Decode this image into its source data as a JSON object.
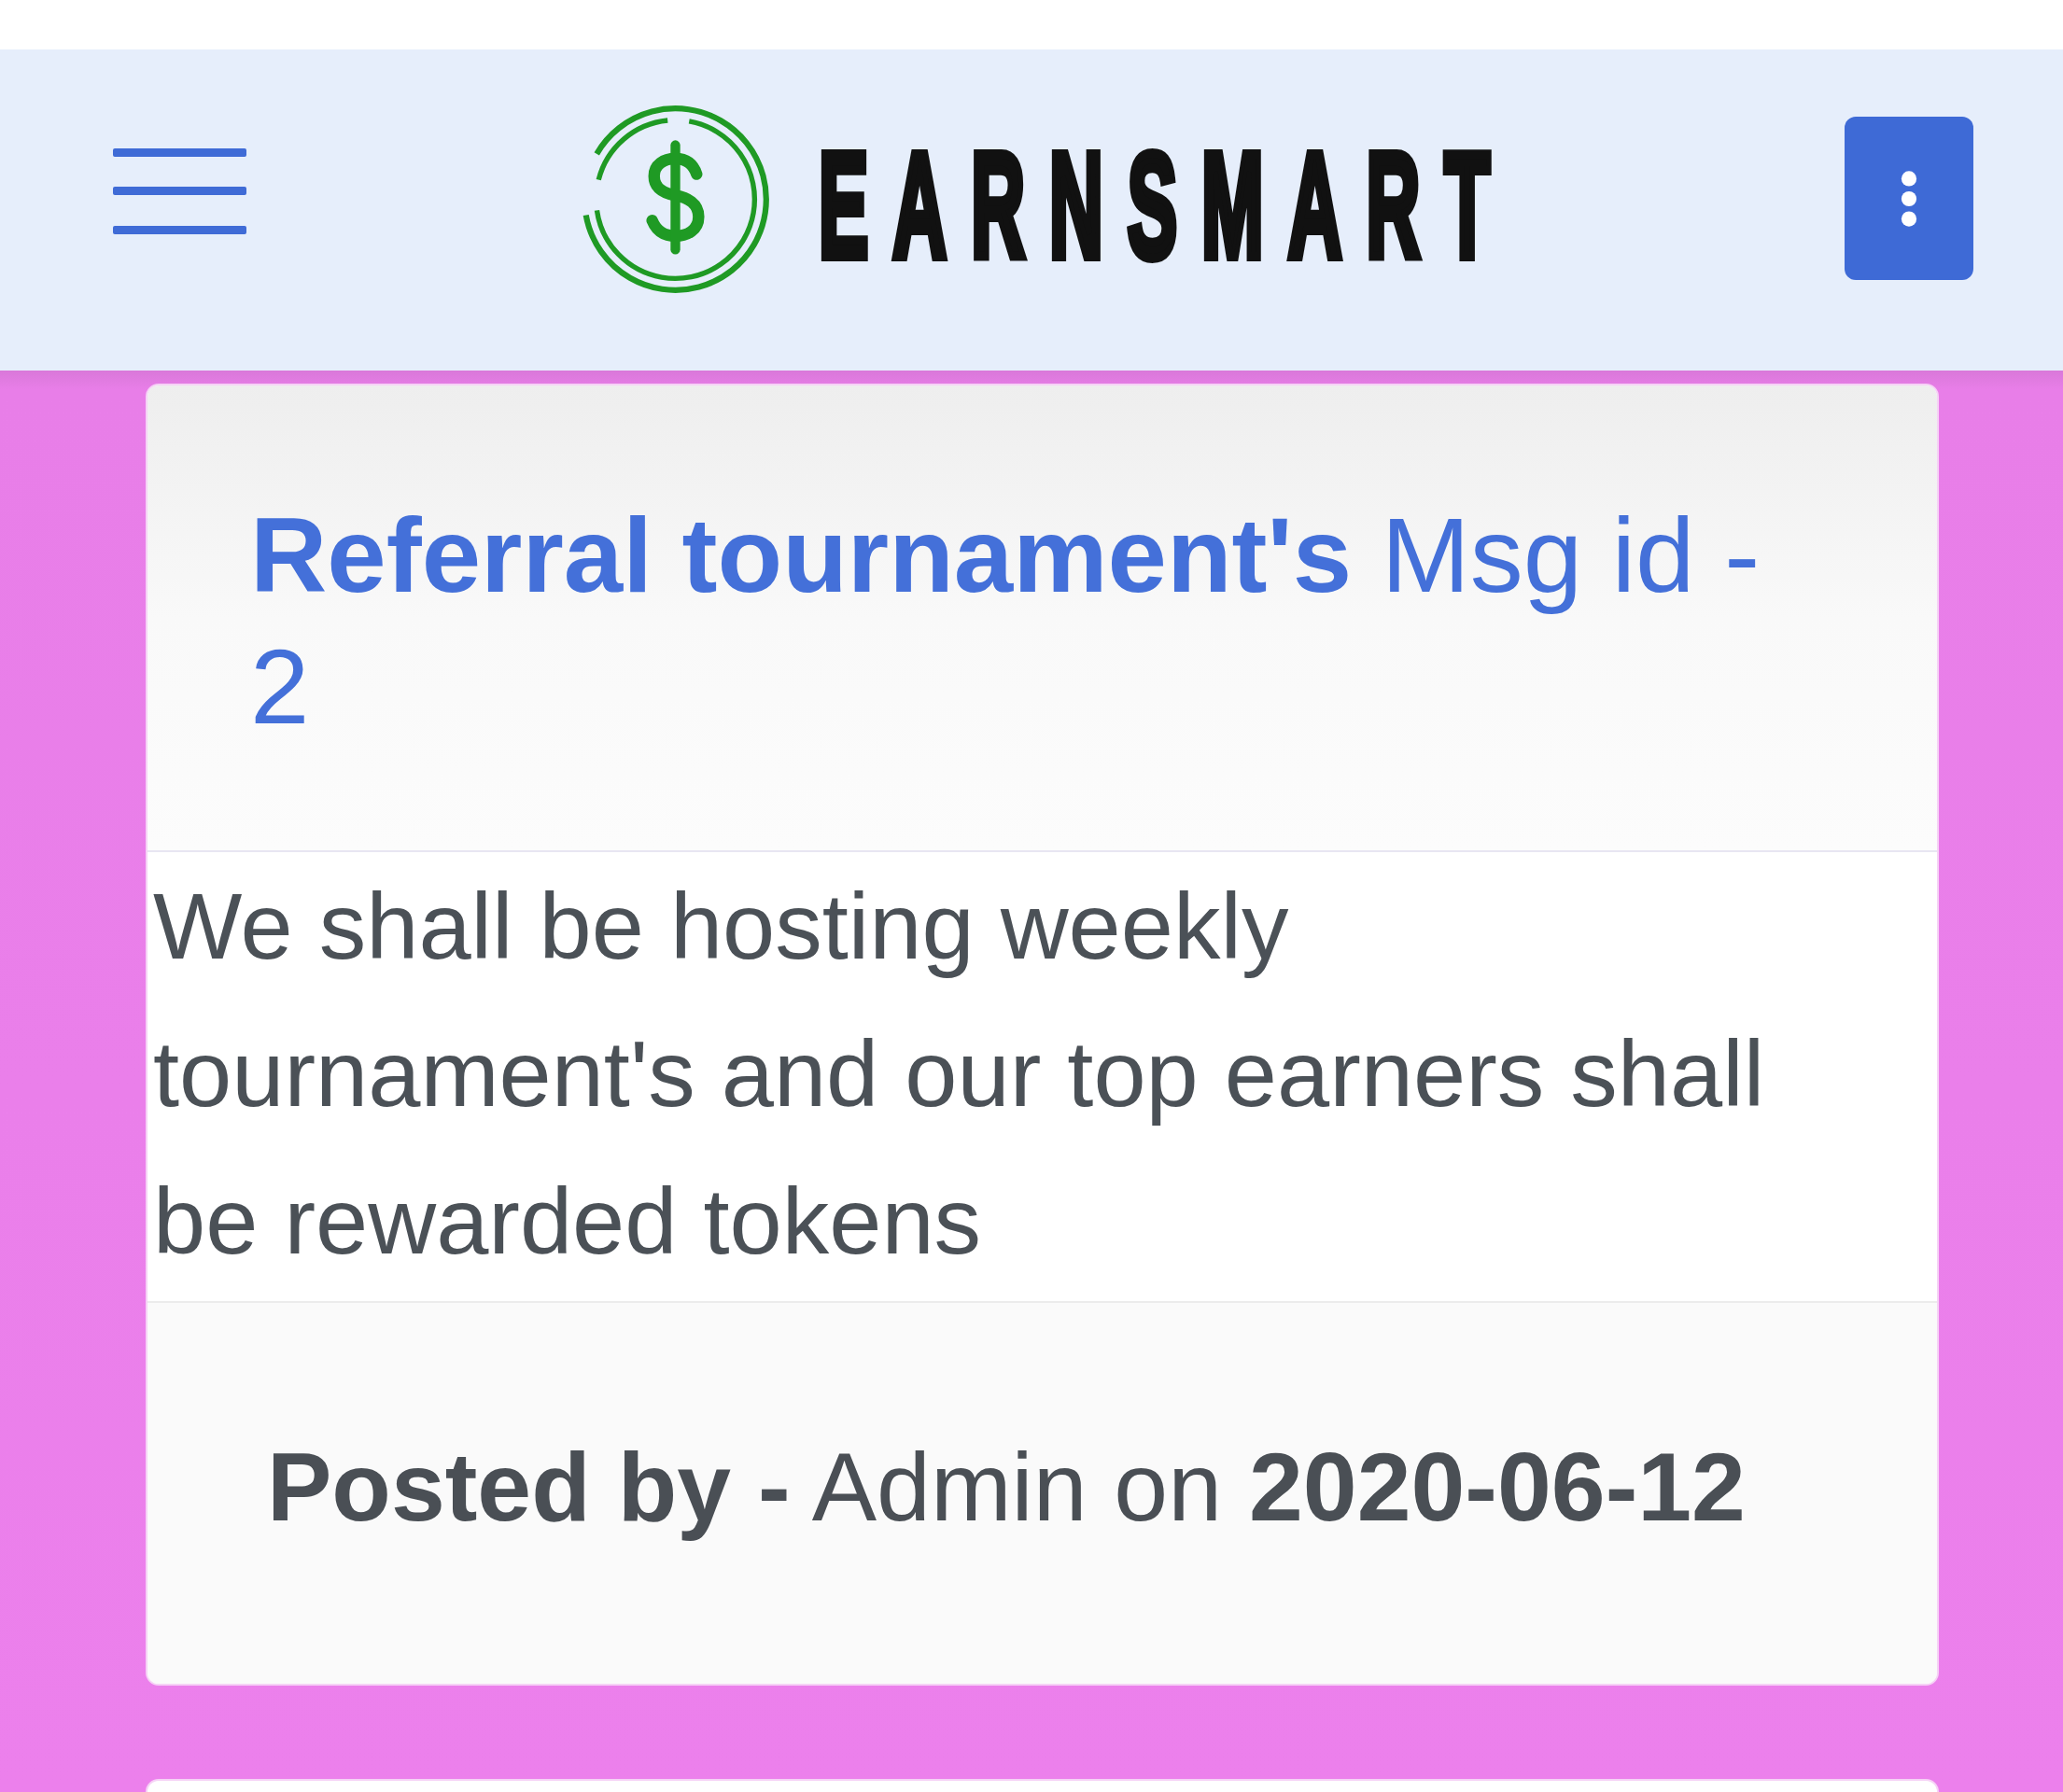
{
  "header": {
    "logo_text": "EARNSMART"
  },
  "messages": [
    {
      "title": "**Referral tournament's** Msg id - 2",
      "body": "We shall be hosting weekly tournament's and our top earners shall be rewarded tokens",
      "footer": "**Posted by -** Admin on **2020-06-12**"
    }
  ]
}
